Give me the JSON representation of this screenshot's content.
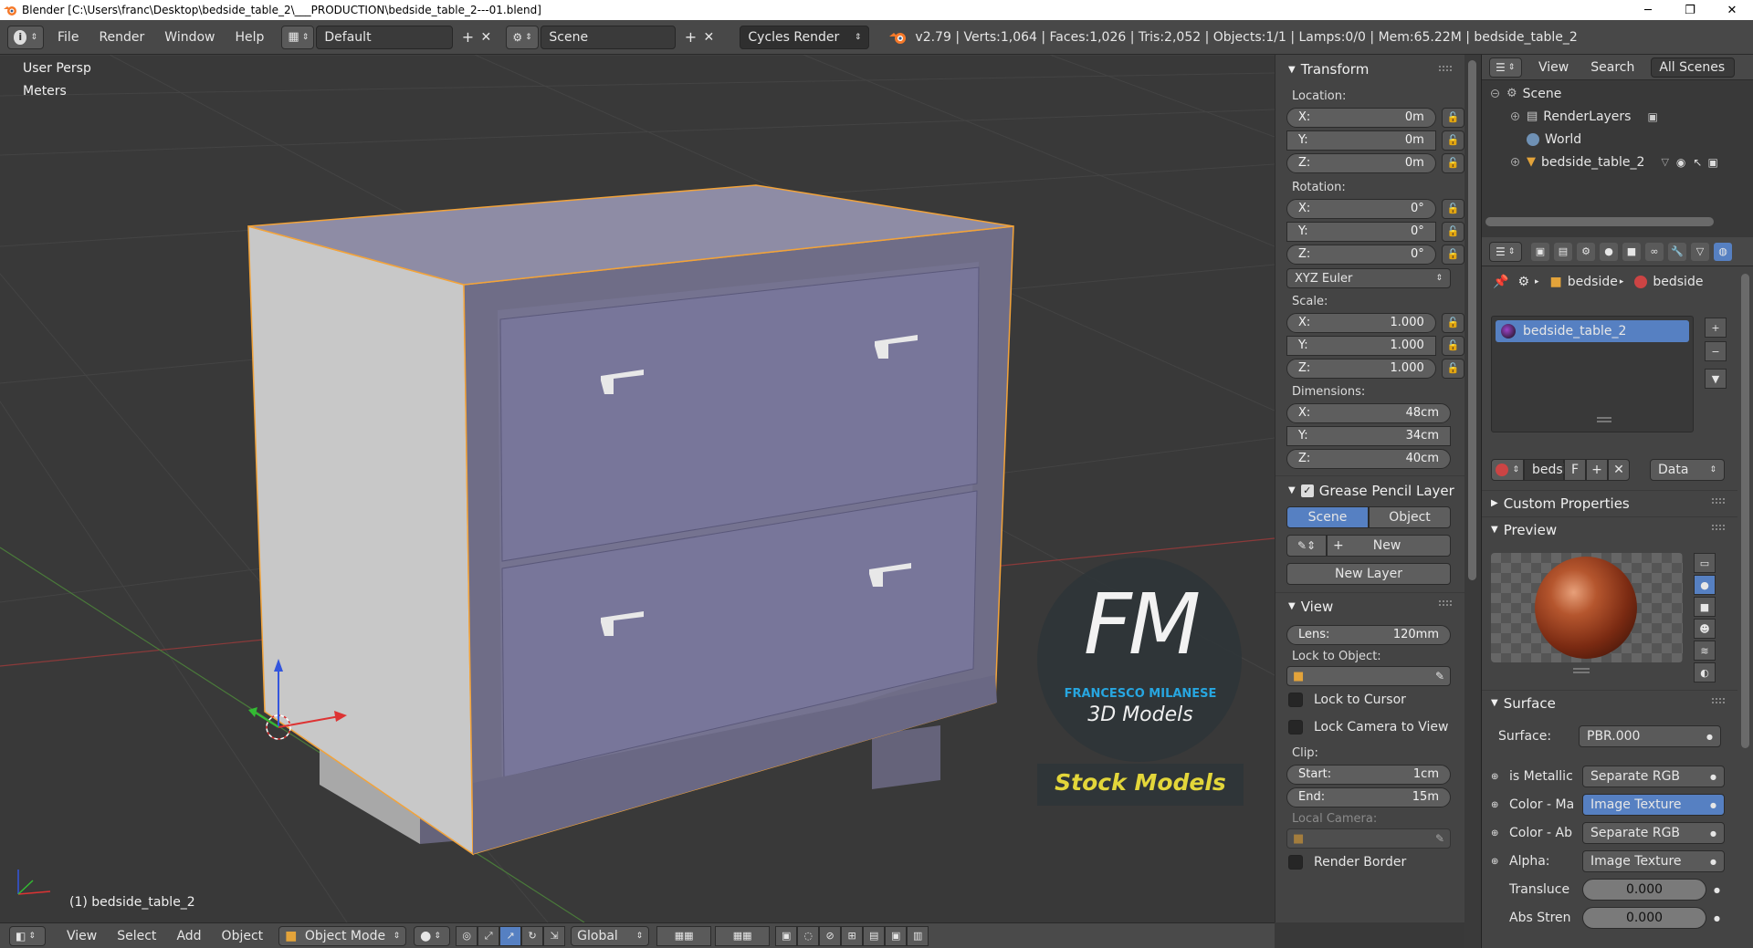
{
  "window": {
    "title": "Blender [C:\\Users\\franc\\Desktop\\bedside_table_2\\___PRODUCTION\\bedside_table_2---01.blend]",
    "minimize": "─",
    "maximize": "❐",
    "close": "✕"
  },
  "info_header": {
    "menus": [
      "File",
      "Render",
      "Window",
      "Help"
    ],
    "layout": "Default",
    "scene": "Scene",
    "engine": "Cycles Render",
    "stats": "v2.79 | Verts:1,064 | Faces:1,026 | Tris:2,052 | Objects:1/1 | Lamps:0/0 | Mem:65.22M | bedside_table_2"
  },
  "viewport": {
    "view_name": "User Persp",
    "units": "Meters",
    "active_object": "(1) bedside_table_2",
    "colors": {
      "background": "#393939",
      "object": "#75738c",
      "outline": "#f2a33a"
    }
  },
  "watermark": {
    "logo": "FM",
    "author": "FRANCESCO MILANESE",
    "subtitle": "3D Models",
    "banner": "Stock Models"
  },
  "transform": {
    "title": "Transform",
    "location_label": "Location:",
    "location": [
      {
        "axis": "X:",
        "value": "0m"
      },
      {
        "axis": "Y:",
        "value": "0m"
      },
      {
        "axis": "Z:",
        "value": "0m"
      }
    ],
    "rotation_label": "Rotation:",
    "rotation": [
      {
        "axis": "X:",
        "value": "0°"
      },
      {
        "axis": "Y:",
        "value": "0°"
      },
      {
        "axis": "Z:",
        "value": "0°"
      }
    ],
    "rotation_mode": "XYZ Euler",
    "scale_label": "Scale:",
    "scale": [
      {
        "axis": "X:",
        "value": "1.000"
      },
      {
        "axis": "Y:",
        "value": "1.000"
      },
      {
        "axis": "Z:",
        "value": "1.000"
      }
    ],
    "dimensions_label": "Dimensions:",
    "dimensions": [
      {
        "axis": "X:",
        "value": "48cm"
      },
      {
        "axis": "Y:",
        "value": "34cm"
      },
      {
        "axis": "Z:",
        "value": "40cm"
      }
    ]
  },
  "grease_pencil": {
    "title": "Grease Pencil Layer",
    "scene_btn": "Scene",
    "object_btn": "Object",
    "new_btn": "New",
    "new_layer_btn": "New Layer"
  },
  "view_panel": {
    "title": "View",
    "lens_label": "Lens:",
    "lens_value": "120mm",
    "lock_object_label": "Lock to Object:",
    "lock_cursor": "Lock to Cursor",
    "lock_camera": "Lock Camera to View",
    "clip_label": "Clip:",
    "clip_start_label": "Start:",
    "clip_start": "1cm",
    "clip_end_label": "End:",
    "clip_end": "15m",
    "local_camera": "Local Camera:",
    "render_border": "Render Border"
  },
  "outliner": {
    "view": "View",
    "search": "Search",
    "filter": "All Scenes",
    "items": [
      "Scene",
      "RenderLayers",
      "World",
      "bedside_table_2"
    ]
  },
  "properties": {
    "breadcrumb1": "bedside",
    "breadcrumb2": "bedside",
    "material_slot": "bedside_table_2",
    "material_name": "bedsi",
    "fake_user": "F",
    "link": "Data",
    "custom_props": "Custom Properties",
    "preview": "Preview",
    "surface_title": "Surface",
    "surface_label": "Surface:",
    "surface_value": "PBR.000",
    "inputs": [
      {
        "label": "is Metallic",
        "value": "Separate RGB",
        "highlight": false
      },
      {
        "label": "Color - Ma",
        "value": "Image Texture",
        "highlight": true
      },
      {
        "label": "Color - Ab",
        "value": "Separate RGB",
        "highlight": false
      },
      {
        "label": "Alpha:",
        "value": "Image Texture",
        "highlight": false
      }
    ],
    "sliders": [
      {
        "label": "Transluce",
        "value": "0.000"
      },
      {
        "label": "Abs Stren",
        "value": "0.000"
      }
    ]
  },
  "bottom_header": {
    "menus": [
      "View",
      "Select",
      "Add",
      "Object"
    ],
    "mode": "Object Mode",
    "orientation": "Global"
  }
}
